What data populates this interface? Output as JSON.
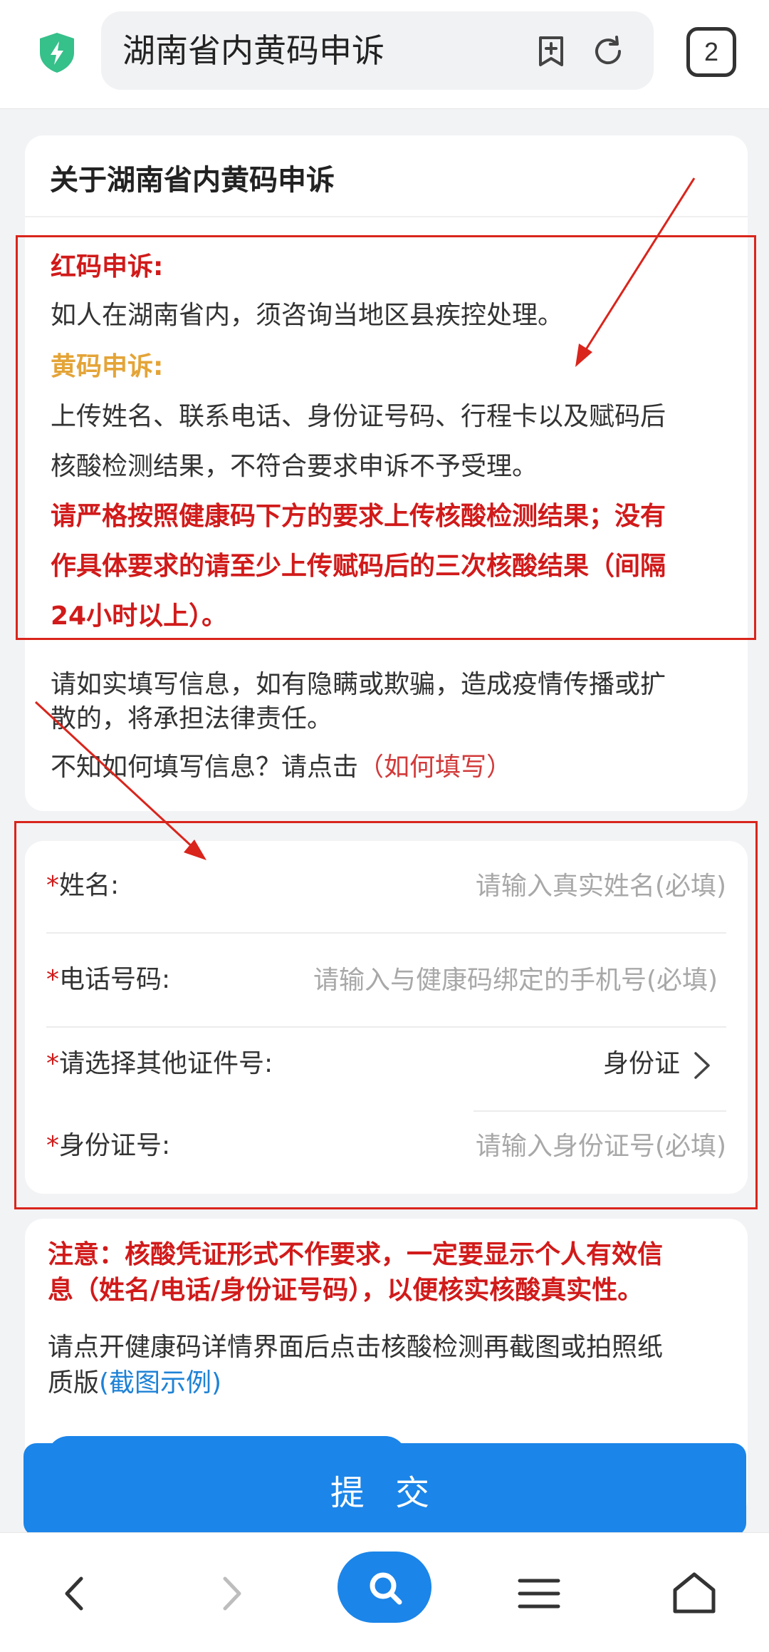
{
  "browser": {
    "page_title": "湖南省内黄码申诉",
    "tab_count": "2"
  },
  "info": {
    "heading": "关于湖南省内黄码申诉",
    "red_title": "红码申诉:",
    "red_text": "如人在湖南省内，须咨询当地区县疾控处理。",
    "yellow_title": "黄码申诉:",
    "yellow_text_1": "上传姓名、联系电话、身份证号码、行程卡以及赋码后",
    "yellow_text_2": "核酸检测结果，不符合要求申诉不予受理。",
    "bold_1": "请严格按照健康码下方的要求上传核酸检测结果；没有",
    "bold_2": "作具体要求的请至少上传赋码后的三次核酸结果（间隔",
    "bold_3": "24小时以上）。",
    "warn_1": "请如实填写信息，如有隐瞒或欺骗，造成疫情传播或扩",
    "warn_2": "散的，将承担法律责任。",
    "howto_prefix": "不知如何填写信息？请点击",
    "howto_link": "（如何填写）"
  },
  "form": {
    "name_label": "姓名:",
    "name_placeholder": "请输入真实姓名(必填)",
    "phone_label": "电话号码:",
    "phone_placeholder": "请输入与健康码绑定的手机号(必填)",
    "idtype_label": "请选择其他证件号:",
    "idtype_value": "身份证",
    "id_label": "身份证号:",
    "id_placeholder": "请输入身份证号(必填)",
    "required_mark": "*"
  },
  "note": {
    "bold_1": "注意：核酸凭证形式不作要求，一定要显示个人有效信",
    "bold_2": "息（姓名/电话/身份证号码），以便核实核酸真实性。",
    "text_1": "请点开健康码详情界面后点击核酸检测再截图或拍照纸",
    "text_2_prefix": "质版",
    "text_2_link": "(截图示例)"
  },
  "submit_label": "提 交",
  "colors": {
    "accent": "#1b85e9",
    "red": "#d11a1a",
    "yellow": "#e4a437",
    "annotation": "#d9251c"
  },
  "icons": {
    "shield": "shield-lightning-icon",
    "bookmark": "bookmark-add-icon",
    "reload": "reload-icon",
    "back": "back-arrow-icon",
    "forward": "forward-arrow-icon",
    "search": "search-icon",
    "menu": "menu-icon",
    "home": "home-icon"
  }
}
